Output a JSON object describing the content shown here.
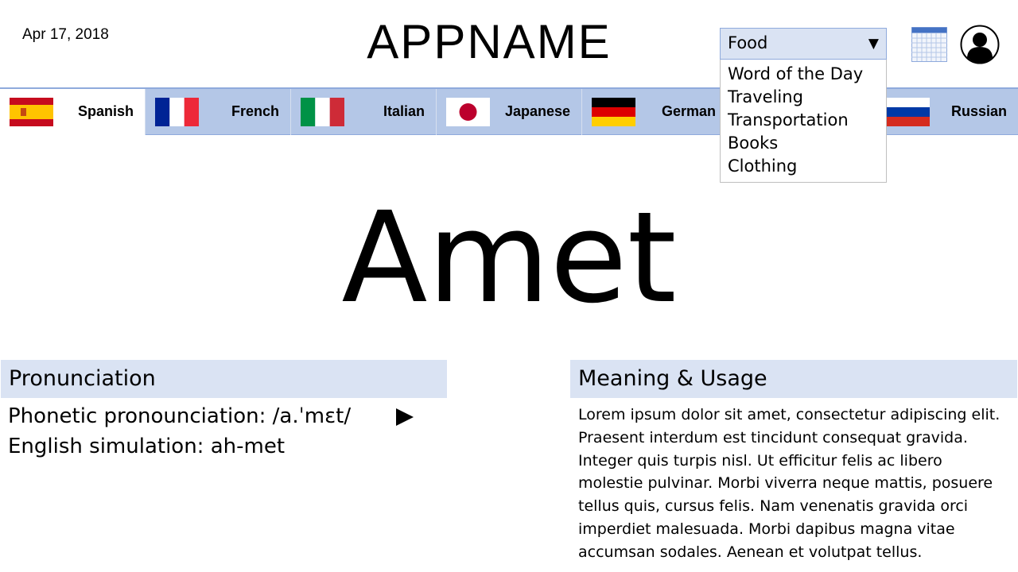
{
  "header": {
    "date": "Apr 17, 2018",
    "app_name": "APPNAME",
    "category_select": {
      "selected": "Food",
      "arrow_glyph": "▼",
      "options": [
        "Word of the Day",
        "Traveling",
        "Transportation",
        "Books",
        "Clothing"
      ]
    },
    "calendar_icon": "calendar-icon",
    "profile_icon": "user-avatar-icon"
  },
  "tabs": [
    {
      "label": "Spanish",
      "flag": "spain-flag-icon",
      "active": true
    },
    {
      "label": "French",
      "flag": "france-flag-icon",
      "active": false
    },
    {
      "label": "Italian",
      "flag": "italy-flag-icon",
      "active": false
    },
    {
      "label": "Japanese",
      "flag": "japan-flag-icon",
      "active": false
    },
    {
      "label": "German",
      "flag": "germany-flag-icon",
      "active": false
    },
    {
      "label": "Russian",
      "flag": "russia-flag-icon",
      "active": false
    }
  ],
  "word": "Amet",
  "pronunciation": {
    "heading": "Pronunciation",
    "phonetic": "Phonetic pronounciation: /a.ˈmɛt/",
    "english_simulation": "English simulation: ah-met",
    "play_icon": "play-icon"
  },
  "meaning": {
    "heading": "Meaning & Usage",
    "lines": [
      "Lorem ipsum dolor sit amet, consectetur adipiscing elit.",
      "Praesent interdum est tincidunt consequat gravida.",
      "Integer quis turpis nisl. Ut efficitur felis ac libero",
      "molestie pulvinar. Morbi viverra neque mattis, posuere",
      "tellus quis, cursus felis. Nam venenatis gravida orci",
      "imperdiet malesuada. Morbi dapibus magna vitae",
      "accumsan sodales. Aenean et volutpat tellus."
    ]
  },
  "colors": {
    "tab_bar": "#b4c7e7",
    "section_header": "#dae3f3",
    "accent_border": "#8faadc"
  }
}
